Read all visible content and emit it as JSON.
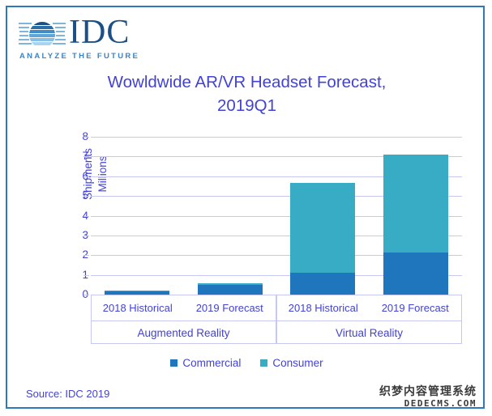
{
  "logo": {
    "mark_name": "idc-globe-icon",
    "wordmark": "IDC",
    "tagline": "ANALYZE THE FUTURE"
  },
  "title": "Wowldwide AR/VR Headset Forecast, 2019Q1",
  "title_line1": "Wowldwide AR/VR Headset Forecast,",
  "title_line2": "2019Q1",
  "axis": {
    "y_label_line1": "Shipments",
    "y_label_line2": "Millions"
  },
  "source": "Source: IDC 2019",
  "watermark": {
    "cn": "织梦内容管理系统",
    "en": "DEDECMS.COM"
  },
  "colors": {
    "commercial": "#2076bc",
    "consumer": "#38acc4",
    "text": "#4242d6",
    "grid": "#c6c8f2",
    "border": "#2e79b8",
    "logo_dark": "#1b4f85",
    "logo_light": "#3c84c4"
  },
  "chart_data": {
    "type": "bar",
    "subtype": "stacked",
    "title": "Wowldwide AR/VR Headset Forecast, 2019Q1",
    "xlabel": "",
    "ylabel": "Shipments Millions",
    "ylim": [
      0,
      8
    ],
    "yticks": [
      "0",
      "1",
      "2",
      "3",
      "4",
      "5",
      "6",
      "7",
      "8"
    ],
    "grid": true,
    "legend_position": "bottom",
    "categories": [
      "2018 Historical",
      "2019 Forecast",
      "2018 Historical",
      "2019 Forecast"
    ],
    "groups": [
      {
        "label": "Augmented Reality",
        "categories": [
          "2018 Historical",
          "2019 Forecast"
        ]
      },
      {
        "label": "Virtual Reality",
        "categories": [
          "2018 Historical",
          "2019 Forecast"
        ]
      }
    ],
    "series": [
      {
        "name": "Commercial",
        "color": "#2076bc",
        "values": [
          0.15,
          0.5,
          1.1,
          2.15
        ]
      },
      {
        "name": "Consumer",
        "color": "#38acc4",
        "values": [
          0.07,
          0.08,
          4.55,
          4.95
        ]
      }
    ],
    "totals": [
      0.22,
      0.58,
      5.65,
      7.1
    ]
  }
}
